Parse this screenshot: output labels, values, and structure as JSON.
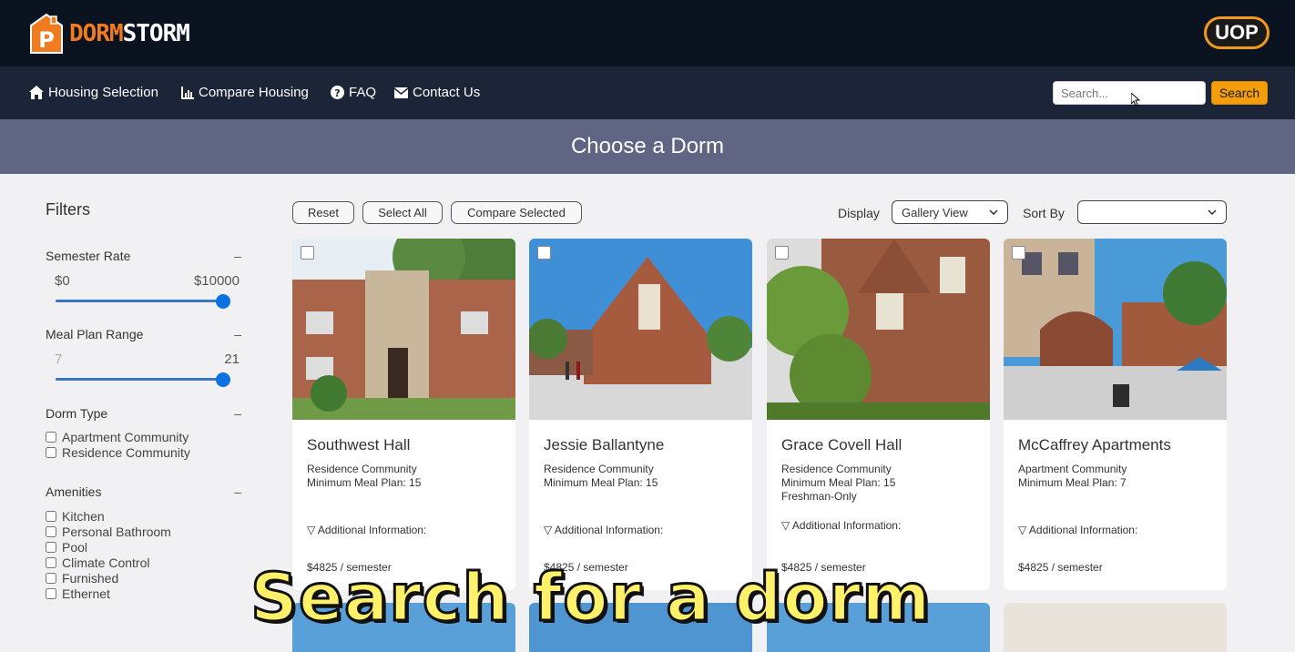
{
  "app": {
    "brand_part1": "DORM",
    "brand_part2": "STORM",
    "badge": "UOP",
    "logo_letter": "P"
  },
  "nav": {
    "items": [
      {
        "label": "Housing Selection",
        "icon": "home-icon"
      },
      {
        "label": "Compare Housing",
        "icon": "chart-icon"
      },
      {
        "label": "FAQ",
        "icon": "question-icon"
      },
      {
        "label": "Contact Us",
        "icon": "envelope-icon"
      }
    ],
    "search_placeholder": "Search...",
    "search_button": "Search"
  },
  "banner": {
    "title": "Choose a Dorm"
  },
  "filters": {
    "title": "Filters",
    "semester_rate": {
      "label": "Semester Rate",
      "collapse": "–",
      "min": "$0",
      "max": "$10000",
      "level": 1.0
    },
    "meal_plan": {
      "label": "Meal Plan Range",
      "collapse": "–",
      "min": "7",
      "max": "21",
      "level": 1.0
    },
    "dorm_type": {
      "label": "Dorm Type",
      "collapse": "–",
      "options": [
        "Apartment Community",
        "Residence Community"
      ]
    },
    "amenities": {
      "label": "Amenities",
      "collapse": "–",
      "options": [
        "Kitchen",
        "Personal Bathroom",
        "Pool",
        "Climate Control",
        "Furnished",
        "Ethernet"
      ]
    }
  },
  "toolbar": {
    "reset": "Reset",
    "select_all": "Select All",
    "compare_selected": "Compare Selected",
    "display_label": "Display",
    "display_value": "Gallery View",
    "sort_label": "Sort By",
    "sort_value": ""
  },
  "cards": [
    {
      "name": "Southwest Hall",
      "type": "Residence Community",
      "meal": "Minimum Meal Plan: 15",
      "extra": "",
      "additional": "▽ Additional Information:",
      "price": "$4825 / semester"
    },
    {
      "name": "Jessie Ballantyne",
      "type": "Residence Community",
      "meal": "Minimum Meal Plan: 15",
      "extra": "",
      "additional": "▽ Additional Information:",
      "price": "$4825 / semester"
    },
    {
      "name": "Grace Covell Hall",
      "type": "Residence Community",
      "meal": "Minimum Meal Plan: 15",
      "extra": "Freshman-Only",
      "additional": "▽ Additional Information:",
      "price": "$4825 / semester"
    },
    {
      "name": "McCaffrey Apartments",
      "type": "Apartment Community",
      "meal": "Minimum Meal Plan: 7",
      "extra": "",
      "additional": "▽ Additional Information:",
      "price": "$4825 / semester"
    }
  ],
  "overlay": {
    "caption": "Search for a dorm"
  },
  "colors": {
    "topbar": "#0b1220",
    "navbar": "#1c2438",
    "banner": "#5f6583",
    "accent": "#f59e0b",
    "brand_orange": "#f07c1f",
    "slider": "#0b73e0"
  }
}
